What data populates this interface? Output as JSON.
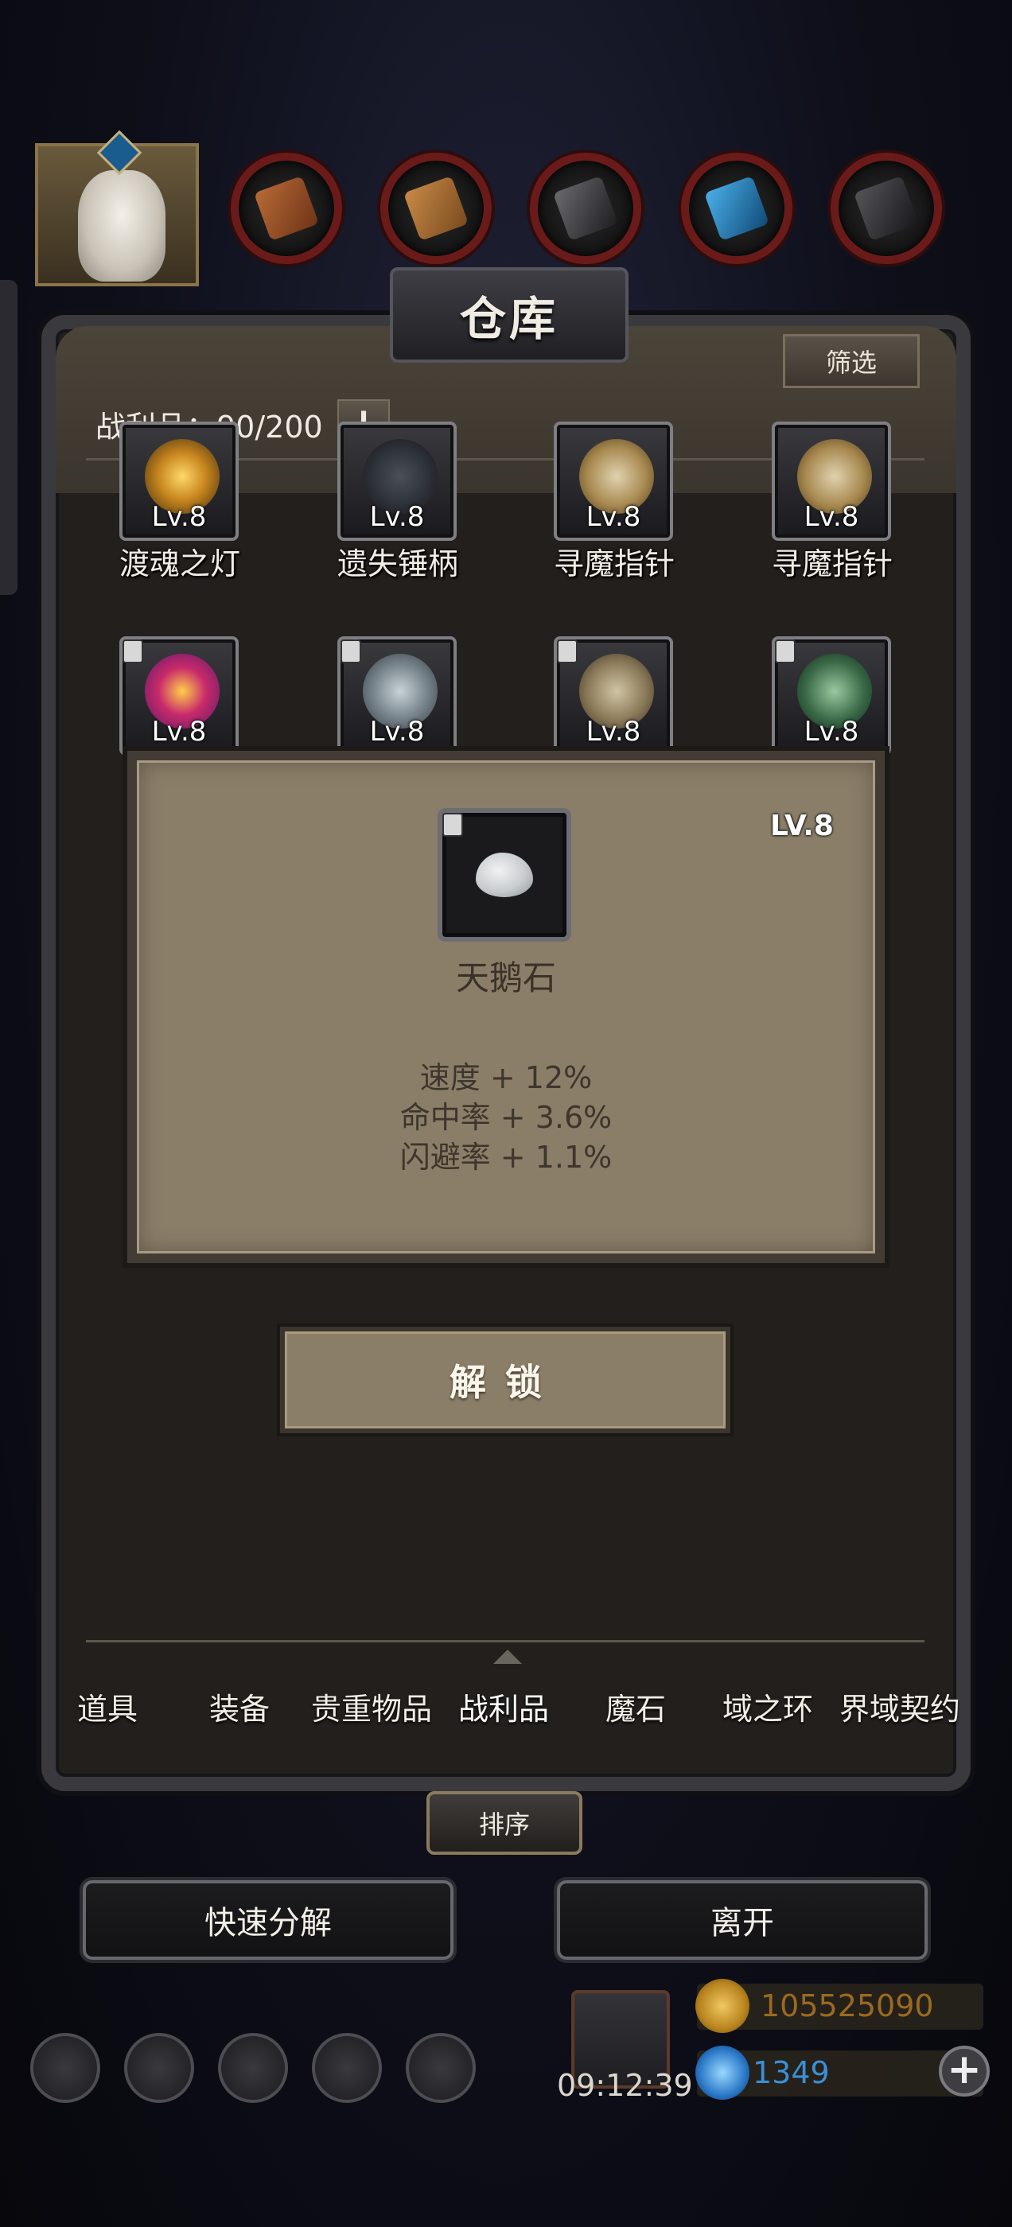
{
  "window": {
    "title": "仓库"
  },
  "toolbar": {
    "filter_label": "筛选"
  },
  "inventory": {
    "count_label": "战利品：90/200",
    "plus_label": "+"
  },
  "items_row1": [
    {
      "level": "Lv.8",
      "name": "渡魂之灯"
    },
    {
      "level": "Lv.8",
      "name": "遗失锤柄"
    },
    {
      "level": "Lv.8",
      "name": "寻魔指针"
    },
    {
      "level": "Lv.8",
      "name": "寻魔指针"
    }
  ],
  "items_row2": [
    {
      "level": "Lv.8"
    },
    {
      "level": "Lv.8"
    },
    {
      "level": "Lv.8"
    },
    {
      "level": "Lv.8"
    }
  ],
  "popup": {
    "level": "LV.8",
    "name": "天鹅石",
    "stats": [
      "速度 + 12%",
      "命中率 + 3.6%",
      "闪避率 + 1.1%"
    ],
    "unlock_label": "解锁"
  },
  "tabs": [
    {
      "label": "道具"
    },
    {
      "label": "装备"
    },
    {
      "label": "贵重物品"
    },
    {
      "label": "战利品"
    },
    {
      "label": "魔石"
    },
    {
      "label": "域之环"
    },
    {
      "label": "界域契约"
    }
  ],
  "sort_label": "排序",
  "actions": {
    "decompose_label": "快速分解",
    "leave_label": "离开"
  },
  "hud": {
    "timer": "09:12:39",
    "gold": "105525090",
    "gems": "1349",
    "add_label": "+"
  },
  "colors": {
    "gold_text": "#9a6a22",
    "gem_text": "#3a8fd6",
    "popup_bg": "#8b7e69"
  }
}
